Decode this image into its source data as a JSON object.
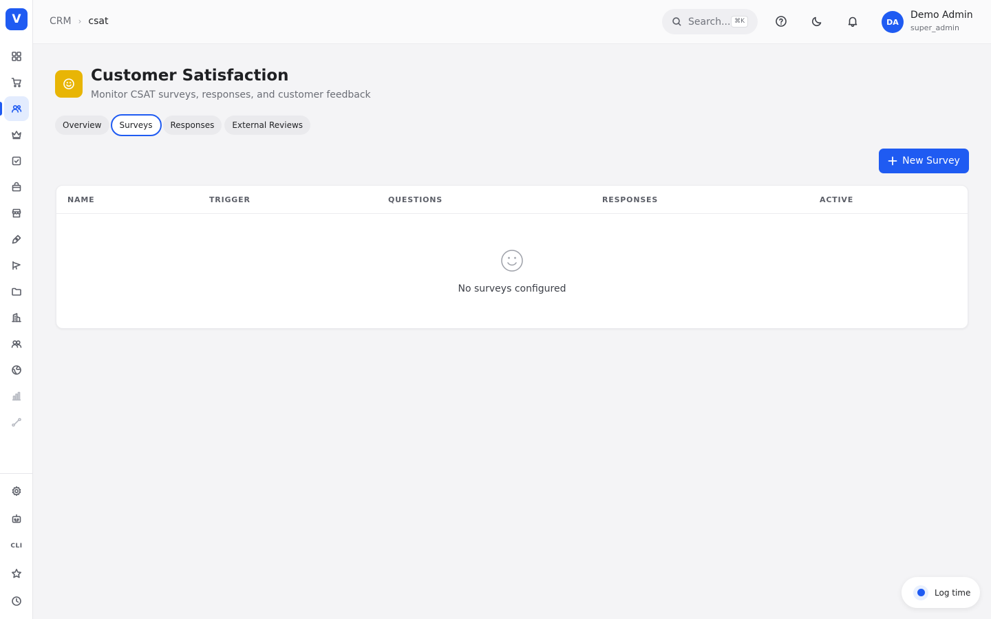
{
  "app": {
    "logo_letter": "V",
    "accent_color": "#1f5bf2"
  },
  "sidebar": {
    "items": [
      {
        "name": "sidebar-item-dashboard",
        "icon": "grid-icon"
      },
      {
        "name": "sidebar-item-orders",
        "icon": "cart-icon"
      },
      {
        "name": "sidebar-item-crm",
        "icon": "users-icon",
        "active": true
      },
      {
        "name": "sidebar-item-loyalty",
        "icon": "crown-icon"
      },
      {
        "name": "sidebar-item-tasks",
        "icon": "checkbox-icon"
      },
      {
        "name": "sidebar-item-products",
        "icon": "bag-icon"
      },
      {
        "name": "sidebar-item-stores",
        "icon": "store-icon"
      },
      {
        "name": "sidebar-item-design",
        "icon": "pen-icon"
      },
      {
        "name": "sidebar-item-marketing",
        "icon": "megaphone-icon"
      },
      {
        "name": "sidebar-item-files",
        "icon": "folder-icon"
      },
      {
        "name": "sidebar-item-company",
        "icon": "building-icon"
      },
      {
        "name": "sidebar-item-team",
        "icon": "team-icon"
      },
      {
        "name": "sidebar-item-web",
        "icon": "globe-icon"
      },
      {
        "name": "sidebar-item-analytics",
        "icon": "bar-chart-icon"
      },
      {
        "name": "sidebar-item-flows",
        "icon": "route-icon"
      }
    ],
    "bottom_items": [
      {
        "name": "sidebar-item-settings",
        "icon": "gear-icon"
      },
      {
        "name": "sidebar-item-bot",
        "icon": "robot-icon"
      },
      {
        "name": "sidebar-item-cli",
        "label": "CLI"
      },
      {
        "name": "sidebar-item-favorites",
        "icon": "star-icon"
      },
      {
        "name": "sidebar-item-history",
        "icon": "clock-icon"
      }
    ],
    "cli_label": "CLI"
  },
  "header": {
    "breadcrumb": {
      "root": "CRM",
      "current": "csat"
    },
    "search": {
      "placeholder": "Search...",
      "shortcut": "⌘K"
    },
    "icons": [
      "help-icon",
      "moon-icon",
      "bell-icon"
    ],
    "user": {
      "initials": "DA",
      "name": "Demo Admin",
      "role": "super_admin"
    }
  },
  "page": {
    "title": "Customer Satisfaction",
    "subtitle": "Monitor CSAT surveys, responses, and customer feedback",
    "icon": "smile-icon",
    "icon_color": "#e8b505"
  },
  "tabs": [
    {
      "label": "Overview",
      "active": false
    },
    {
      "label": "Surveys",
      "active": true
    },
    {
      "label": "Responses",
      "active": false
    },
    {
      "label": "External Reviews",
      "active": false
    }
  ],
  "actions": {
    "new_survey_label": "New Survey"
  },
  "table": {
    "columns": [
      "NAME",
      "TRIGGER",
      "QUESTIONS",
      "RESPONSES",
      "ACTIVE"
    ],
    "rows": [],
    "empty_text": "No surveys configured"
  },
  "floating": {
    "log_time_label": "Log time"
  }
}
